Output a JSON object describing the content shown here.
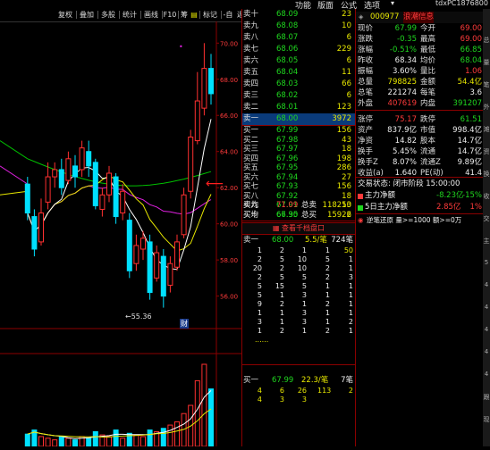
{
  "menu": {
    "items": [
      "功能",
      "版面",
      "公式",
      "选项"
    ],
    "ticker": "tdxPC1876800"
  },
  "toolbar": {
    "buttons": [
      "复权",
      "叠加",
      "多股",
      "统计",
      "画线",
      "F10",
      "筹",
      "标记",
      "-自选",
      "返回"
    ]
  },
  "chart": {
    "y_ticks": [
      "70.00",
      "68.00",
      "66.00",
      "64.00",
      "62.00",
      "60.00",
      "58.00",
      "56.00"
    ],
    "low_label": "←55.36",
    "cai_label": "财",
    "colors": {
      "up": "#ff3030",
      "down": "#00e0ff",
      "ma5": "#ffffff",
      "ma10": "#e8e800",
      "ma20": "#e020e0",
      "ma60": "#00c000"
    }
  },
  "chart_data": {
    "type": "candlestick",
    "ylim": [
      54.4,
      71.2
    ],
    "y_ticks": [
      56,
      58,
      60,
      62,
      64,
      66,
      68,
      70
    ],
    "candles": [
      {
        "o": 62.2,
        "c": 60.6,
        "h": 62.6,
        "l": 60.2
      },
      {
        "o": 60.4,
        "c": 58.6,
        "h": 60.8,
        "l": 58.2
      },
      {
        "o": 59.0,
        "c": 60.6,
        "h": 61.4,
        "l": 58.8
      },
      {
        "o": 61.2,
        "c": 62.6,
        "h": 63.4,
        "l": 60.8
      },
      {
        "o": 62.6,
        "c": 63.0,
        "h": 63.4,
        "l": 62.0
      },
      {
        "o": 63.0,
        "c": 62.0,
        "h": 63.6,
        "l": 61.6
      },
      {
        "o": 62.4,
        "c": 63.6,
        "h": 64.0,
        "l": 62.2
      },
      {
        "o": 63.2,
        "c": 62.6,
        "h": 63.8,
        "l": 62.0
      },
      {
        "o": 63.0,
        "c": 64.2,
        "h": 64.6,
        "l": 62.6
      },
      {
        "o": 64.0,
        "c": 63.2,
        "h": 64.6,
        "l": 62.6
      },
      {
        "o": 63.4,
        "c": 61.0,
        "h": 63.6,
        "l": 60.8
      },
      {
        "o": 60.8,
        "c": 61.6,
        "h": 62.0,
        "l": 60.4
      },
      {
        "o": 61.6,
        "c": 62.8,
        "h": 63.2,
        "l": 61.2
      },
      {
        "o": 62.6,
        "c": 60.4,
        "h": 62.8,
        "l": 60.0
      },
      {
        "o": 60.6,
        "c": 61.8,
        "h": 62.2,
        "l": 60.2
      },
      {
        "o": 60.2,
        "c": 57.4,
        "h": 60.6,
        "l": 57.0
      },
      {
        "o": 57.8,
        "c": 58.8,
        "h": 59.4,
        "l": 57.4
      },
      {
        "o": 58.6,
        "c": 59.2,
        "h": 59.6,
        "l": 58.0
      },
      {
        "o": 59.0,
        "c": 56.2,
        "h": 59.4,
        "l": 55.8
      },
      {
        "o": 57.0,
        "c": 58.4,
        "h": 58.8,
        "l": 56.8
      },
      {
        "o": 58.2,
        "c": 56.0,
        "h": 58.6,
        "l": 55.36
      },
      {
        "o": 56.6,
        "c": 57.8,
        "h": 58.2,
        "l": 56.2
      },
      {
        "o": 57.6,
        "c": 59.0,
        "h": 59.4,
        "l": 57.4
      },
      {
        "o": 59.4,
        "c": 61.6,
        "h": 62.0,
        "l": 59.2
      },
      {
        "o": 61.8,
        "c": 64.8,
        "h": 65.2,
        "l": 61.4
      },
      {
        "o": 64.6,
        "c": 66.8,
        "h": 68.4,
        "l": 64.4
      },
      {
        "o": 66.4,
        "c": 68.6,
        "h": 70.0,
        "l": 66.0
      },
      {
        "o": 68.6,
        "c": 67.2,
        "h": 69.4,
        "l": 66.6
      }
    ],
    "volumes": [
      0.15,
      0.2,
      0.12,
      0.1,
      0.08,
      0.12,
      0.1,
      0.08,
      0.12,
      0.1,
      0.18,
      0.14,
      0.12,
      0.2,
      0.1,
      0.16,
      0.14,
      0.12,
      0.2,
      0.18,
      0.22,
      0.26,
      0.3,
      0.4,
      0.5,
      0.8,
      1.0,
      0.7
    ]
  },
  "orderbook": {
    "sell": [
      {
        "label": "卖十",
        "price": "68.09",
        "vol": "23"
      },
      {
        "label": "卖九",
        "price": "68.08",
        "vol": "10"
      },
      {
        "label": "卖八",
        "price": "68.07",
        "vol": "6"
      },
      {
        "label": "卖七",
        "price": "68.06",
        "vol": "229"
      },
      {
        "label": "卖六",
        "price": "68.05",
        "vol": "6"
      },
      {
        "label": "卖五",
        "price": "68.04",
        "vol": "11"
      },
      {
        "label": "卖四",
        "price": "68.03",
        "vol": "66"
      },
      {
        "label": "卖三",
        "price": "68.02",
        "vol": "6"
      },
      {
        "label": "卖二",
        "price": "68.01",
        "vol": "123"
      },
      {
        "label": "卖一",
        "price": "68.00",
        "vol": "3972"
      }
    ],
    "buy": [
      {
        "label": "买一",
        "price": "67.99",
        "vol": "156"
      },
      {
        "label": "买二",
        "price": "67.98",
        "vol": "43"
      },
      {
        "label": "买三",
        "price": "67.97",
        "vol": "18"
      },
      {
        "label": "买四",
        "price": "67.96",
        "vol": "198"
      },
      {
        "label": "买五",
        "price": "67.95",
        "vol": "286"
      },
      {
        "label": "买六",
        "price": "67.94",
        "vol": "27"
      },
      {
        "label": "买七",
        "price": "67.93",
        "vol": "156"
      },
      {
        "label": "买八",
        "price": "67.92",
        "vol": "18"
      },
      {
        "label": "买九",
        "price": "67.91",
        "vol": "10"
      },
      {
        "label": "买十",
        "price": "67.90",
        "vol": "6"
      }
    ],
    "avg": [
      {
        "label": "卖均",
        "price": "71.09",
        "mid": "总卖",
        "vol": "118253"
      },
      {
        "label": "买均",
        "price": "66.35",
        "mid": "总买",
        "vol": "15922"
      }
    ],
    "queue_title": "查看千档盘口",
    "sell_queue": {
      "label": "卖一",
      "price": "68.00",
      "ratio": "5.5/笔",
      "total": "724笔"
    },
    "sell_queue_rows": [
      [
        "1",
        "2",
        "1",
        "1",
        "50"
      ],
      [
        "2",
        "5",
        "10",
        "5",
        "1"
      ],
      [
        "20",
        "2",
        "10",
        "2",
        "1"
      ],
      [
        "2",
        "5",
        "5",
        "2",
        "3"
      ],
      [
        "5",
        "15",
        "5",
        "1",
        "1"
      ],
      [
        "5",
        "1",
        "3",
        "1",
        "1"
      ],
      [
        "9",
        "2",
        "1",
        "2",
        "1"
      ],
      [
        "1",
        "1",
        "3",
        "1",
        "1"
      ],
      [
        "3",
        "1",
        "3",
        "1",
        "2"
      ],
      [
        "1",
        "2",
        "1",
        "2",
        "1"
      ]
    ],
    "buy_queue": {
      "label": "买一",
      "price": "67.99",
      "ratio": "22.3/笔",
      "total": "7笔"
    },
    "buy_queue_rows": [
      [
        "4",
        "6",
        "26",
        "113",
        "2"
      ],
      [
        "4",
        "3",
        "3",
        "",
        ""
      ]
    ]
  },
  "quote": {
    "header": {
      "code": "000977",
      "name": "浪潮信息"
    },
    "rows": [
      {
        "a": "现价",
        "b": "67.99",
        "bc": "green",
        "c": "今开",
        "d": "69.00",
        "dc": "red"
      },
      {
        "a": "涨跌",
        "b": "-0.35",
        "bc": "green",
        "c": "最高",
        "d": "69.00",
        "dc": "red"
      },
      {
        "a": "涨幅",
        "b": "-0.51%",
        "bc": "green",
        "c": "最低",
        "d": "66.85",
        "dc": "green"
      },
      {
        "a": "昨收",
        "b": "68.34",
        "bc": "white",
        "c": "均价",
        "d": "68.04",
        "dc": "green"
      },
      {
        "a": "振幅",
        "b": "3.60%",
        "bc": "white",
        "c": "量比",
        "d": "1.06",
        "dc": "red"
      },
      {
        "a": "总量",
        "b": "798825",
        "bc": "yellow",
        "c": "金额",
        "d": "54.4亿",
        "dc": "yellow"
      },
      {
        "a": "总笔",
        "b": "221274",
        "bc": "white",
        "c": "每笔",
        "d": "3.6",
        "dc": "white"
      },
      {
        "a": "外盘",
        "b": "407619",
        "bc": "red",
        "c": "内盘",
        "d": "391207",
        "dc": "green"
      },
      {
        "a": "涨停",
        "b": "75.17",
        "bc": "red",
        "c": "跌停",
        "d": "61.51",
        "dc": "green"
      },
      {
        "a": "资产",
        "b": "837.9亿",
        "bc": "white",
        "c": "市值",
        "d": "998.4亿",
        "dc": "white"
      },
      {
        "a": "净资",
        "b": "14.82",
        "bc": "white",
        "c": "股本",
        "d": "14.7亿",
        "dc": "white"
      },
      {
        "a": "换手",
        "b": "5.45%",
        "bc": "white",
        "c": "流通",
        "d": "14.7亿",
        "dc": "white"
      },
      {
        "a": "换手Z",
        "b": "8.07%",
        "bc": "white",
        "c": "流通Z",
        "d": "9.89亿",
        "dc": "white"
      },
      {
        "a": "收益(a)",
        "b": "1.640",
        "bc": "white",
        "c": "PE(动)",
        "d": "41.4",
        "dc": "white"
      }
    ],
    "status": "交易状态: 闭市阶段 15:00:00",
    "net1": {
      "label": "主力净额",
      "val": "-8.23亿",
      "pct": "-15%"
    },
    "net2": {
      "label": "5日主力净额",
      "val": "2.85亿",
      "pct": "1%"
    },
    "toolbar": "逆笔还原  量>=1000  额>=0万",
    "side_chars": [
      "总",
      "量",
      "笔",
      "外",
      "滩",
      "资",
      "换",
      "收",
      "交",
      "主",
      "5",
      "4",
      "4",
      "4",
      "4",
      "4",
      "跟",
      "现"
    ]
  }
}
